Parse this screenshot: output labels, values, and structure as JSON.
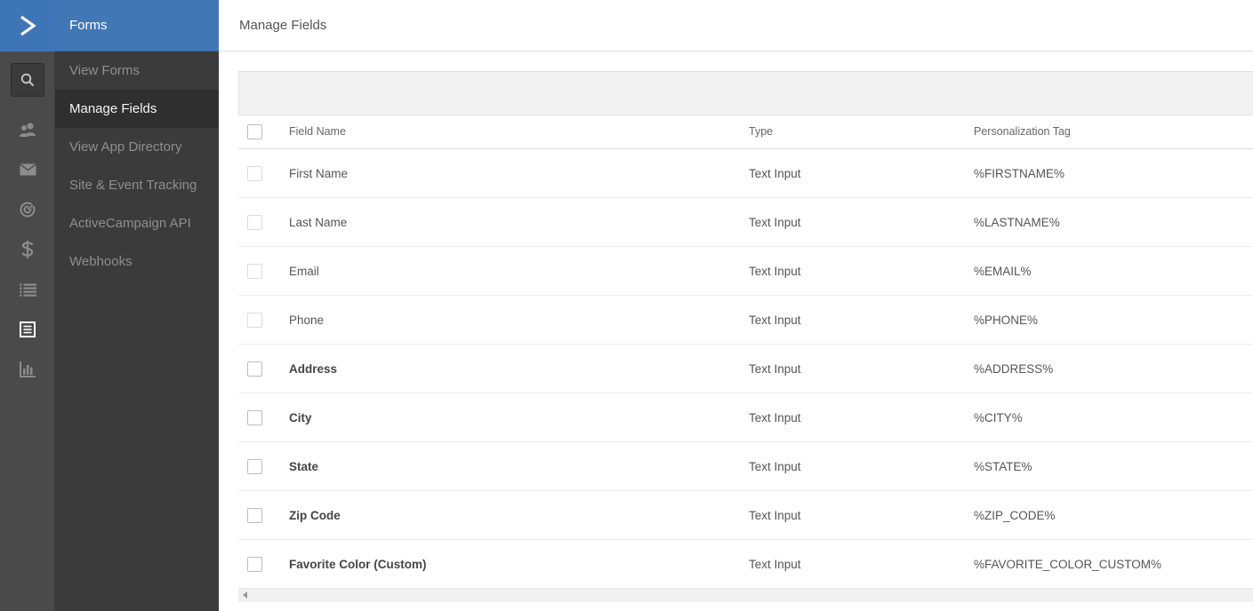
{
  "nav": {
    "section_title": "Forms",
    "items": [
      {
        "label": "View Forms"
      },
      {
        "label": "Manage Fields"
      },
      {
        "label": "View App Directory"
      },
      {
        "label": "Site & Event Tracking"
      },
      {
        "label": "ActiveCampaign API"
      },
      {
        "label": "Webhooks"
      }
    ],
    "active_index": 1
  },
  "rail": {
    "icons": [
      "logo-chevron-icon",
      "search-icon",
      "contacts-icon",
      "envelope-icon",
      "target-icon",
      "dollar-icon",
      "list-icon",
      "document-icon",
      "bar-chart-icon"
    ]
  },
  "page": {
    "title": "Manage Fields"
  },
  "table": {
    "columns": [
      "Field Name",
      "Type",
      "Personalization Tag"
    ],
    "rows": [
      {
        "name": "First Name",
        "type": "Text Input",
        "tag": "%FIRSTNAME%",
        "bold": false,
        "selectable": false
      },
      {
        "name": "Last Name",
        "type": "Text Input",
        "tag": "%LASTNAME%",
        "bold": false,
        "selectable": false
      },
      {
        "name": "Email",
        "type": "Text Input",
        "tag": "%EMAIL%",
        "bold": false,
        "selectable": false
      },
      {
        "name": "Phone",
        "type": "Text Input",
        "tag": "%PHONE%",
        "bold": false,
        "selectable": false
      },
      {
        "name": "Address",
        "type": "Text Input",
        "tag": "%ADDRESS%",
        "bold": true,
        "selectable": true
      },
      {
        "name": "City",
        "type": "Text Input",
        "tag": "%CITY%",
        "bold": true,
        "selectable": true
      },
      {
        "name": "State",
        "type": "Text Input",
        "tag": "%STATE%",
        "bold": true,
        "selectable": true
      },
      {
        "name": "Zip Code",
        "type": "Text Input",
        "tag": "%ZIP_CODE%",
        "bold": true,
        "selectable": true
      },
      {
        "name": "Favorite Color (Custom)",
        "type": "Text Input",
        "tag": "%FAVORITE_COLOR_CUSTOM%",
        "bold": true,
        "selectable": true
      }
    ]
  },
  "colors": {
    "brand_blue": "#3e75b7",
    "rail_bg": "#4a4a4b",
    "submenu_bg": "#3b3b3c"
  }
}
